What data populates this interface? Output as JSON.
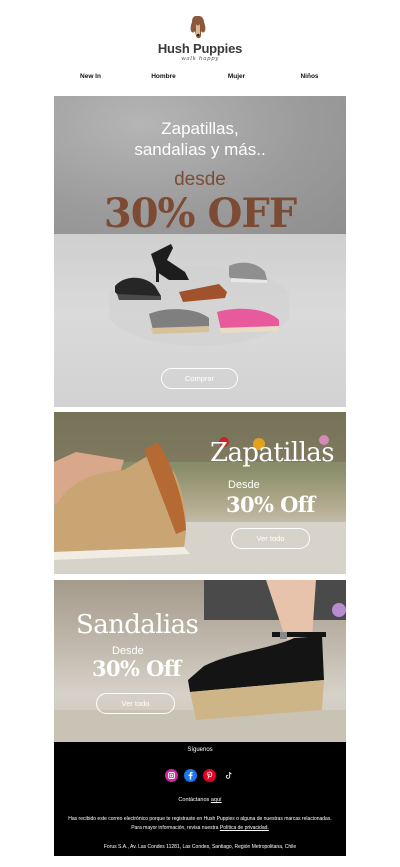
{
  "brand": {
    "name": "Hush Puppies",
    "tagline": "walk happy"
  },
  "nav": {
    "items": [
      "New In",
      "Hombre",
      "Mujer",
      "Niños"
    ]
  },
  "hero": {
    "headline_line1": "Zapatillas,",
    "headline_line2": "sandalias y más..",
    "desde": "desde",
    "discount": "30% OFF",
    "button": "Comprar",
    "accent_color": "#7d4a33"
  },
  "promo_zapatillas": {
    "title": "Zapatillas",
    "desde": "Desde",
    "discount": "30% Off",
    "button": "Ver todo"
  },
  "promo_sandalias": {
    "title": "Sandalias",
    "desde": "Desde",
    "discount": "30% Off",
    "button": "Ver todo"
  },
  "footer": {
    "follow": "Síguenos",
    "socials": [
      "instagram-icon",
      "facebook-icon",
      "pinterest-icon",
      "tiktok-icon"
    ],
    "contact_prefix": "Contáctanos",
    "contact_link": "aquí",
    "legal_line1": "Has recibido este correo electrónico porque te registraste en Hush Puppies o alguna de nuestras marcas relacionadas.",
    "legal_line2_prefix": "Para mayor información, revisa nuestra",
    "legal_link": "Política de privacidad.",
    "address": "Forus S.A., Av. Las Condes 11281, Las Condes, Santiago, Región Metropolitana, Chile"
  }
}
